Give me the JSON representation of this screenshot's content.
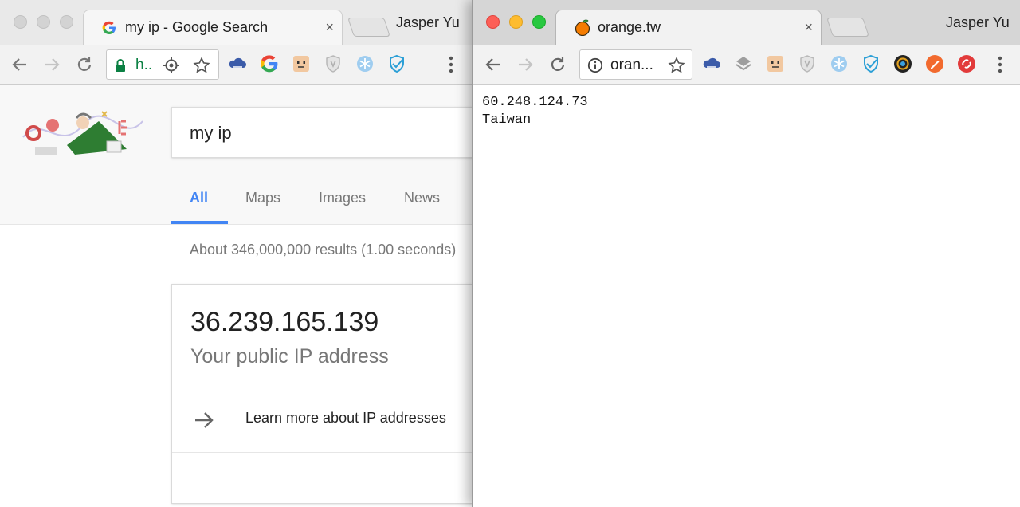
{
  "left_window": {
    "tab": {
      "title": "my ip - Google Search",
      "close": "×"
    },
    "profile": "Jasper Yu",
    "omnibox": {
      "text": "h.."
    },
    "page": {
      "query": "my ip",
      "tabs": [
        {
          "label": "All"
        },
        {
          "label": "Maps"
        },
        {
          "label": "Images"
        },
        {
          "label": "News"
        }
      ],
      "result_stats": "About 346,000,000 results (1.00 seconds)",
      "ip_card": {
        "ip": "36.239.165.139",
        "caption": "Your public IP address",
        "learn_more": "Learn more about IP addresses"
      }
    },
    "google_colors": {
      "blue": "#4285f4",
      "red": "#ea4335",
      "yellow": "#fbbc05",
      "green": "#34a853"
    }
  },
  "right_window": {
    "tab": {
      "title": "orange.tw",
      "close": "×"
    },
    "profile": "Jasper Yu",
    "omnibox": {
      "text": "oran..."
    },
    "page": {
      "ip": "60.248.124.73",
      "country": "Taiwan"
    }
  }
}
